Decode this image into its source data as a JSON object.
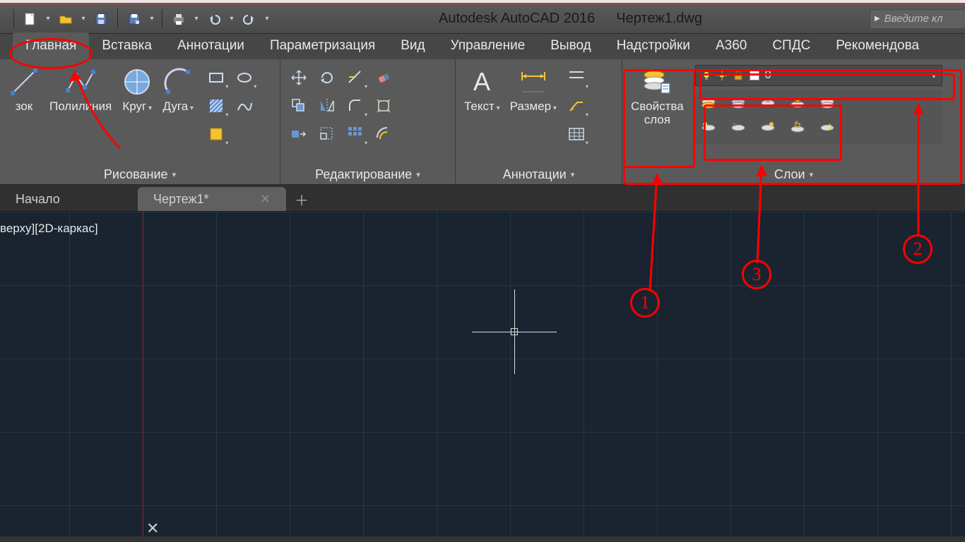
{
  "app_title": "Autodesk AutoCAD 2016",
  "file_title": "Чертеж1.dwg",
  "search_placeholder": "Введите кл",
  "tabs": [
    "Главная",
    "Вставка",
    "Аннотации",
    "Параметризация",
    "Вид",
    "Управление",
    "Вывод",
    "Надстройки",
    "A360",
    "СПДС",
    "Рекомендова"
  ],
  "panels": {
    "draw": "Рисование",
    "modify": "Редактирование",
    "annotation": "Аннотации",
    "layers": "Слои"
  },
  "draw_buttons": {
    "segment": "зок",
    "polyline": "Полилиния",
    "circle": "Круг",
    "arc": "Дуга"
  },
  "annot_buttons": {
    "text": "Текст",
    "dim": "Размер"
  },
  "layer_button": "Свойства\nслоя",
  "current_layer": "0",
  "file_tabs": {
    "home": "Начало",
    "active": "Чертеж1*"
  },
  "view_label": "верху][2D-каркас]",
  "callouts": {
    "n1": "1",
    "n2": "2",
    "n3": "3"
  }
}
